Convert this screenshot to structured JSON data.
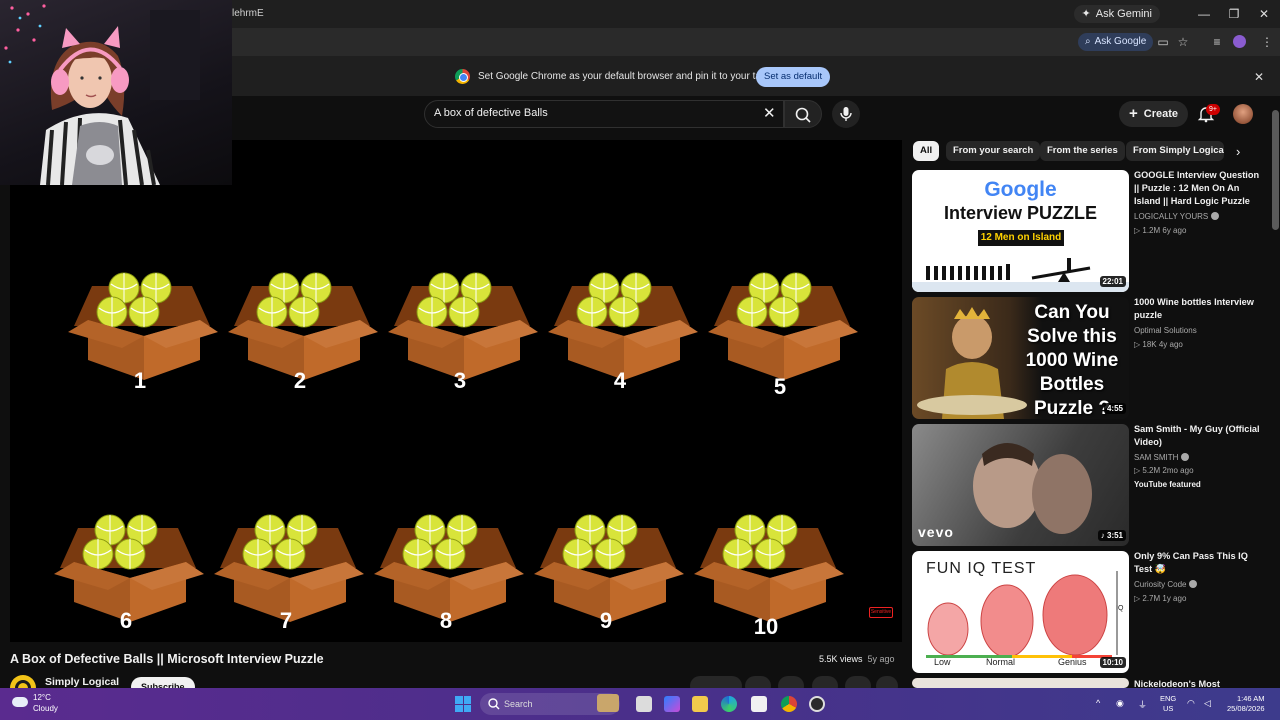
{
  "browser": {
    "ask_gemini": "Ask Gemini",
    "url_fragment": "lehrmE",
    "ask_google": "Ask Google",
    "infobar_text": "Set Google Chrome as your default browser and pin it to your taskbar",
    "set_default_label": "Set as default"
  },
  "youtube": {
    "search_query": "A box of defective Balls",
    "create_label": "Create",
    "notifications_badge": "9+",
    "video": {
      "title": "A Box of Defective Balls || Microsoft Interview Puzzle",
      "views": "5.5K views",
      "age": "5y ago",
      "channel": "Simply Logical",
      "subscribe_label": "Subscribe",
      "box_labels": [
        "1",
        "2",
        "3",
        "4",
        "5",
        "6",
        "7",
        "8",
        "9",
        "10"
      ],
      "ad_chip": "Sensitive"
    },
    "chips": [
      "All",
      "From your search",
      "From the series",
      "From Simply Logical"
    ],
    "recommendations": [
      {
        "title": "GOOGLE Interview Question || Puzzle : 12 Men On An Island || Hard Logic Puzzle",
        "channel": "LOGICALLY YOURS",
        "meta": "▷ 1.2M  6y ago",
        "duration": "22:01",
        "thumb_line1": "Google",
        "thumb_line2": "Interview PUZZLE",
        "thumb_line3": "12 Men on Island"
      },
      {
        "title": "1000 Wine bottles Interview puzzle",
        "channel": "Optimal Solutions",
        "meta": "▷ 18K  4y ago",
        "duration": "4:55",
        "thumb_text": "Can You Solve this 1000 Wine Bottles Puzzle ?"
      },
      {
        "title": "Sam Smith - My Guy (Official Video)",
        "channel": "SAM SMITH",
        "meta": "▷ 5.2M  2mo ago",
        "badge": "YouTube featured",
        "duration": "♪ 3:51",
        "thumb_logo": "vevo"
      },
      {
        "title": "Only 9% Can Pass This IQ Test 🤯",
        "channel": "Curiosity Code",
        "meta": "▷ 2.7M  1y ago",
        "duration": "10:10",
        "thumb_title": "FUN IQ TEST",
        "thumb_labels": [
          "Low",
          "Normal",
          "Genius"
        ],
        "thumb_axis": "IQ"
      },
      {
        "title": "Nickelodeon's Most"
      }
    ]
  },
  "taskbar": {
    "temp": "12°C",
    "weather": "Cloudy",
    "search_label": "Search",
    "lang_line1": "ENG",
    "lang_line2": "US",
    "time": "1:46 AM",
    "date": "25/08/2026"
  }
}
